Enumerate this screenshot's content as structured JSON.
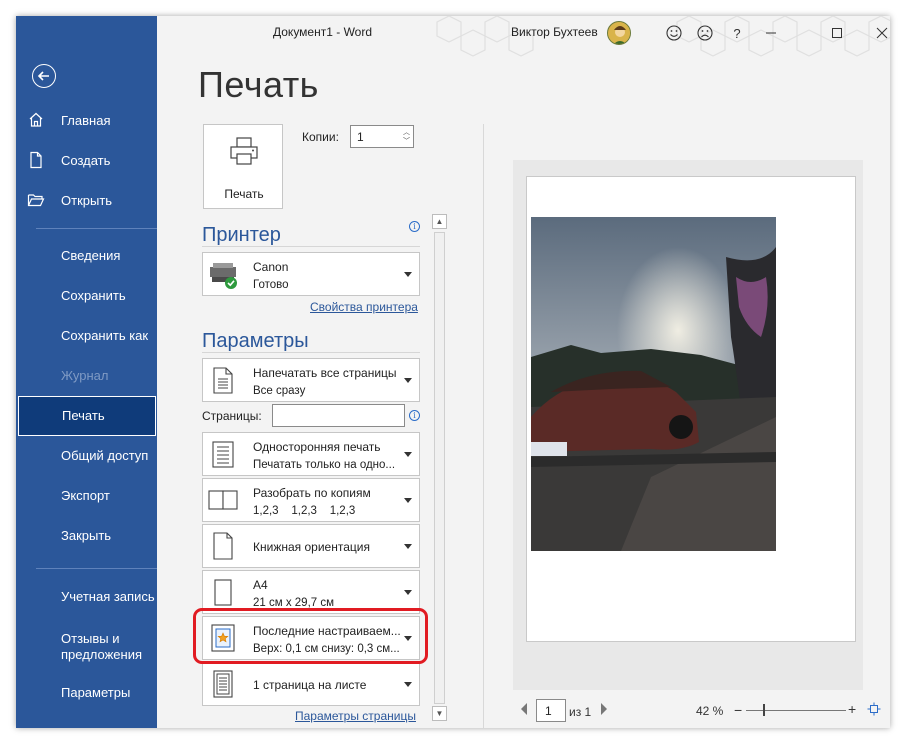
{
  "window": {
    "doc_title": "Документ1  -  Word",
    "user_name": "Виктор Бухтеев",
    "controls": {
      "help": "?"
    }
  },
  "sidebar": {
    "items": [
      {
        "label": "Главная",
        "icon": "home-icon"
      },
      {
        "label": "Создать",
        "icon": "new-document-icon"
      },
      {
        "label": "Открыть",
        "icon": "folder-icon"
      },
      {
        "label": "Сведения"
      },
      {
        "label": "Сохранить"
      },
      {
        "label": "Сохранить как"
      },
      {
        "label": "Журнал",
        "disabled": true
      },
      {
        "label": "Печать",
        "active": true
      },
      {
        "label": "Общий доступ"
      },
      {
        "label": "Экспорт"
      },
      {
        "label": "Закрыть"
      },
      {
        "label": "Учетная запись"
      },
      {
        "label": "Отзывы и предложения"
      },
      {
        "label": "Параметры"
      }
    ]
  },
  "print": {
    "heading": "Печать",
    "button_label": "Печать",
    "copies_label": "Копии:",
    "copies_value": "1"
  },
  "printer": {
    "section_title": "Принтер",
    "name": "Canon",
    "status": "Готово",
    "properties_link": "Свойства принтера"
  },
  "settings": {
    "section_title": "Параметры",
    "pages_label": "Страницы:",
    "pages_value": "",
    "dropdowns": [
      {
        "line1": "Напечатать все страницы",
        "line2": "Все сразу"
      },
      {
        "line1": "Односторонняя печать",
        "line2": "Печатать только на одно..."
      },
      {
        "line1": "Разобрать по копиям",
        "line2": "1,2,3    1,2,3    1,2,3"
      },
      {
        "line1": "Книжная ориентация"
      },
      {
        "line1": "A4",
        "line2": "21 см x 29,7 см"
      },
      {
        "line1": "Последние настраиваем...",
        "line2": "Верх: 0,1 см снизу: 0,3 см..."
      },
      {
        "line1": "1 страница на листе"
      }
    ],
    "page_setup_link": "Параметры страницы"
  },
  "preview": {
    "current_page": "1",
    "of_pages": "из 1",
    "zoom": "42 %",
    "zoom_level": 0.42
  },
  "colors": {
    "sidebar": "#2b579a",
    "accent": "#2b579a",
    "highlight": "#e11b22"
  }
}
